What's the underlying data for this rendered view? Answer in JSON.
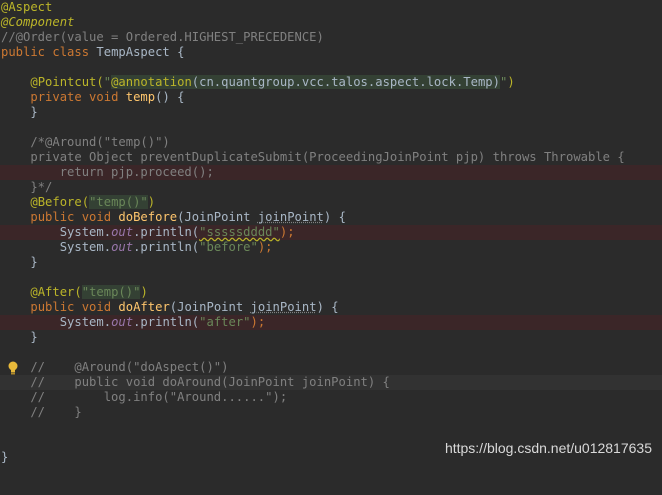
{
  "editor": {
    "lines": {
      "l1": "@Aspect",
      "l2": "@Component",
      "l3": "//@Order(value = Ordered.HIGHEST_PRECEDENCE)",
      "l4_k": "public class ",
      "l4_name": "TempAspect {",
      "l6_ann": "@Pointcut(",
      "l6_str_q1": "\"",
      "l6_str_ann": "@annotation",
      "l6_str_body": "(cn.quantgroup.vcc.talos.aspect.lock.Temp)",
      "l6_str_q2": "\"",
      "l6_close": ")",
      "l7_k": "private void ",
      "l7_fn": "temp",
      "l7_rest": "() {",
      "l8": "    }",
      "l10": "    /*@Around(\"temp()\")",
      "l11": "    private Object preventDuplicateSubmit(ProceedingJoinPoint pjp) throws Throwable {",
      "l12": "        return pjp.proceed();",
      "l13": "    }*/",
      "l14_ann": "@Before(",
      "l14_str": "\"temp()\"",
      "l14_close": ")",
      "l15_k": "public void ",
      "l15_fn": "doBefore",
      "l15_a": "(JoinPoint ",
      "l15_p": "joinPoint",
      "l15_b": ") {",
      "l16_a": "System.",
      "l16_out": "out",
      "l16_b": ".println(",
      "l16_str": "\"sssssdddd\"",
      "l16_c": ");",
      "l17_a": "System.",
      "l17_out": "out",
      "l17_b": ".println(",
      "l17_str": "\"before\"",
      "l17_c": ");",
      "l18": "    }",
      "l20_ann": "@After(",
      "l20_str": "\"temp()\"",
      "l20_close": ")",
      "l21_k": "public void ",
      "l21_fn": "doAfter",
      "l21_a": "(JoinPoint ",
      "l21_p": "joinPoint",
      "l21_b": ") {",
      "l22_a": "System.",
      "l22_out": "out",
      "l22_b": ".println(",
      "l22_str": "\"after\"",
      "l22_c": ");",
      "l23": "    }",
      "l25": "    //    @Around(\"doAspect()\")",
      "l26": "    //    public void doAround(JoinPoint joinPoint) {",
      "l27": "    //        log.info(\"Around......\");",
      "l28": "    //    }",
      "l31": "}"
    }
  },
  "watermark": "https://blog.csdn.net/u012817635",
  "icons": {
    "bulb": "lightbulb-icon"
  },
  "colors": {
    "background": "#2b2b2b",
    "keyword": "#cc7832",
    "annotation": "#bbb529",
    "string": "#6a8759",
    "comment": "#808080",
    "function": "#ffc66d",
    "field": "#9876aa",
    "breakpoint_line": "#3b2628"
  }
}
